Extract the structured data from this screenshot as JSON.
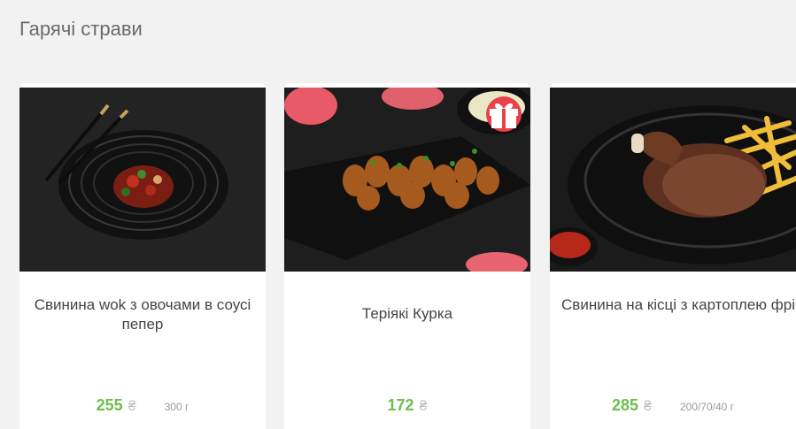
{
  "section": {
    "title": "Гарячі страви"
  },
  "colors": {
    "price": "#6cbf4a",
    "gift_badge": "#e8414a"
  },
  "products": [
    {
      "name": "Свинина wok з овочами в соусі пепер",
      "price": "255",
      "currency": "₴",
      "weight": "300 г"
    },
    {
      "name": "Теріякі Курка",
      "price": "172",
      "currency": "₴",
      "weight": "",
      "badge_icon": "gift-icon"
    },
    {
      "name": "Свинина на кісці з картоплею фрі",
      "price": "285",
      "currency": "₴",
      "weight": "200/70/40 г"
    }
  ]
}
